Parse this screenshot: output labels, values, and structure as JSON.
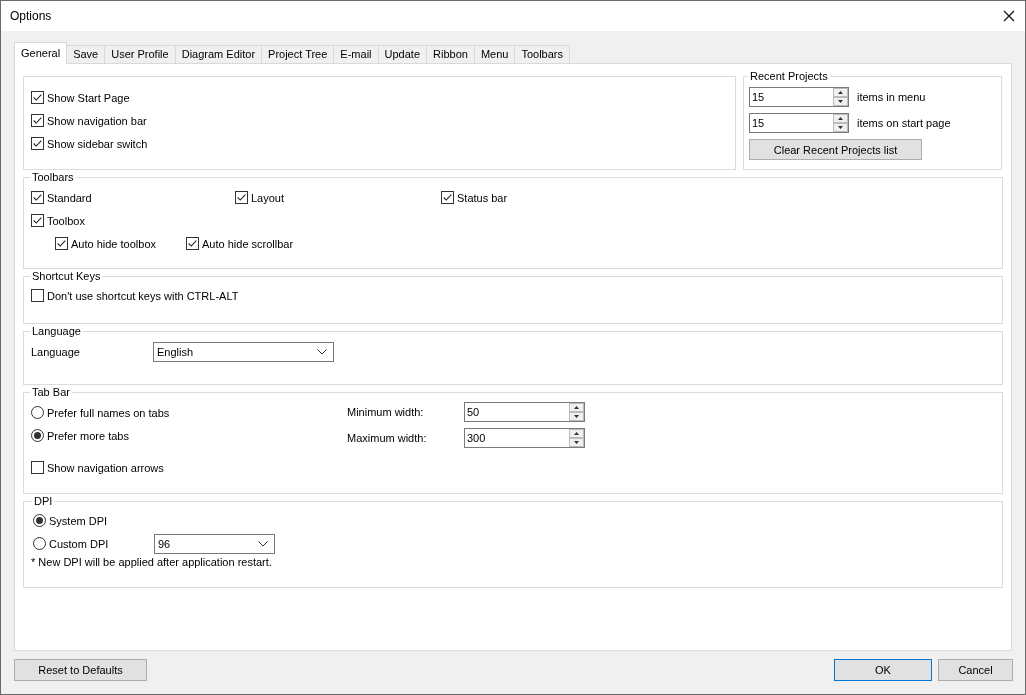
{
  "window": {
    "title": "Options"
  },
  "tabs": [
    {
      "label": "General",
      "selected": true
    },
    {
      "label": "Save",
      "selected": false
    },
    {
      "label": "User Profile",
      "selected": false
    },
    {
      "label": "Diagram Editor",
      "selected": false
    },
    {
      "label": "Project Tree",
      "selected": false
    },
    {
      "label": "E-mail",
      "selected": false
    },
    {
      "label": "Update",
      "selected": false
    },
    {
      "label": "Ribbon",
      "selected": false
    },
    {
      "label": "Menu",
      "selected": false
    },
    {
      "label": "Toolbars",
      "selected": false
    }
  ],
  "general": {
    "options": [
      {
        "label": "Show Start Page",
        "checked": true
      },
      {
        "label": "Show navigation bar",
        "checked": true
      },
      {
        "label": "Show sidebar switch",
        "checked": true
      }
    ]
  },
  "recent_projects": {
    "title": "Recent Projects",
    "spinners": [
      {
        "value": "15",
        "label": "items in menu"
      },
      {
        "value": "15",
        "label": "items on start page"
      }
    ],
    "button": "Clear Recent Projects list"
  },
  "toolbars": {
    "title": "Toolbars",
    "options": [
      {
        "label": "Standard",
        "checked": true
      },
      {
        "label": "Layout",
        "checked": true
      },
      {
        "label": "Status bar",
        "checked": true
      },
      {
        "label": "Toolbox",
        "checked": true,
        "children": [
          {
            "label": "Auto hide toolbox",
            "checked": true
          },
          {
            "label": "Auto hide scrollbar",
            "checked": true
          }
        ]
      }
    ]
  },
  "shortcut_keys": {
    "title": "Shortcut Keys",
    "options": [
      {
        "label": "Don't use shortcut keys with CTRL-ALT",
        "checked": false
      }
    ]
  },
  "language": {
    "title": "Language",
    "label": "Language",
    "value": "English"
  },
  "tab_bar": {
    "title": "Tab Bar",
    "radios": [
      {
        "label": "Prefer full names on tabs",
        "selected": false
      },
      {
        "label": "Prefer more tabs",
        "selected": true
      }
    ],
    "checkbox": {
      "label": "Show navigation arrows",
      "checked": false
    },
    "widths": [
      {
        "label": "Minimum width:",
        "value": "50"
      },
      {
        "label": "Maximum width:",
        "value": "300"
      }
    ]
  },
  "dpi": {
    "title": "DPI",
    "radios": [
      {
        "label": "System DPI",
        "selected": true
      },
      {
        "label": "Custom DPI",
        "selected": false
      }
    ],
    "custom_value": "96",
    "note": "* New DPI will be applied after application restart."
  },
  "reset_button": {
    "label": "Reset to Defaults"
  },
  "dialog_buttons": [
    {
      "label": "OK",
      "default": true
    },
    {
      "label": "Cancel",
      "default": false
    }
  ]
}
